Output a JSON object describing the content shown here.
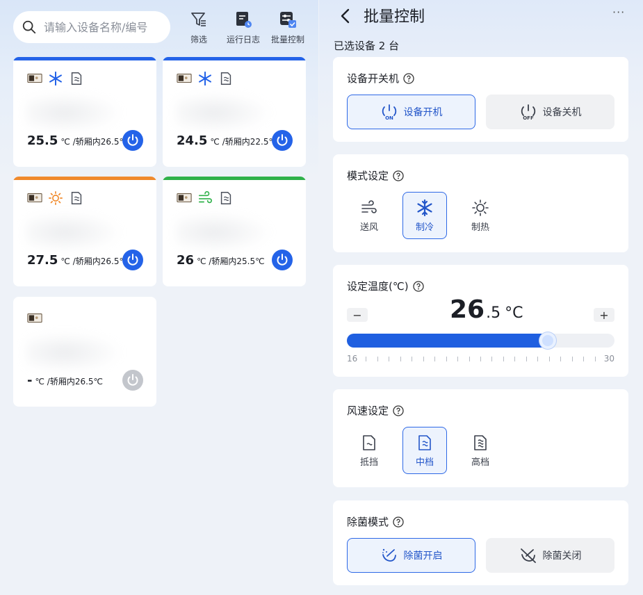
{
  "left": {
    "search": {
      "placeholder": "请输入设备名称/编号"
    },
    "tools": [
      {
        "label": "筛选",
        "icon": "filter-icon"
      },
      {
        "label": "运行日志",
        "icon": "log-icon"
      },
      {
        "label": "批量控制",
        "icon": "batch-control-icon"
      }
    ],
    "devices": [
      {
        "bar_color": "#2463e8",
        "mode_icon": "snowflake-icon",
        "temp": "25.5",
        "unit_text": "℃ /轿厢内26.5℃",
        "power_on": true
      },
      {
        "bar_color": "#2463e8",
        "mode_icon": "snowflake-icon",
        "temp": "24.5",
        "unit_text": "℃ /轿厢内22.5℃",
        "power_on": true
      },
      {
        "bar_color": "#f08a2c",
        "mode_icon": "sun-icon",
        "temp": "27.5",
        "unit_text": "℃ /轿厢内26.5℃",
        "power_on": true
      },
      {
        "bar_color": "#2fb14a",
        "mode_icon": "wind-icon",
        "temp": "26",
        "unit_text": "℃ /轿厢内25.5℃",
        "power_on": true
      },
      {
        "bar_color": "",
        "mode_icon": "",
        "temp": "-",
        "unit_text": "℃ /轿厢内26.5℃",
        "power_on": false
      }
    ]
  },
  "right": {
    "title": "批量控制",
    "more": "···",
    "selected_text": "已选设备 2 台",
    "power_section": {
      "title": "设备开关机",
      "on_label": "设备开机",
      "off_label": "设备关机",
      "selected": "on"
    },
    "mode_section": {
      "title": "模式设定",
      "options": [
        "送风",
        "制冷",
        "制热"
      ],
      "selected": "制冷"
    },
    "temp_section": {
      "title": "设定温度(℃)",
      "value_int": "26",
      "value_dec": ".5",
      "unit": "°C",
      "minus": "−",
      "plus": "+",
      "min_label": "16",
      "max_label": "30",
      "min": 16,
      "max": 30,
      "value": 26.5
    },
    "fan_section": {
      "title": "风速设定",
      "options": [
        "抵挡",
        "中档",
        "高档"
      ],
      "selected": "中档"
    },
    "sterilize_section": {
      "title": "除菌模式",
      "on_label": "除菌开启",
      "off_label": "除菌关闭",
      "selected": "on"
    }
  }
}
